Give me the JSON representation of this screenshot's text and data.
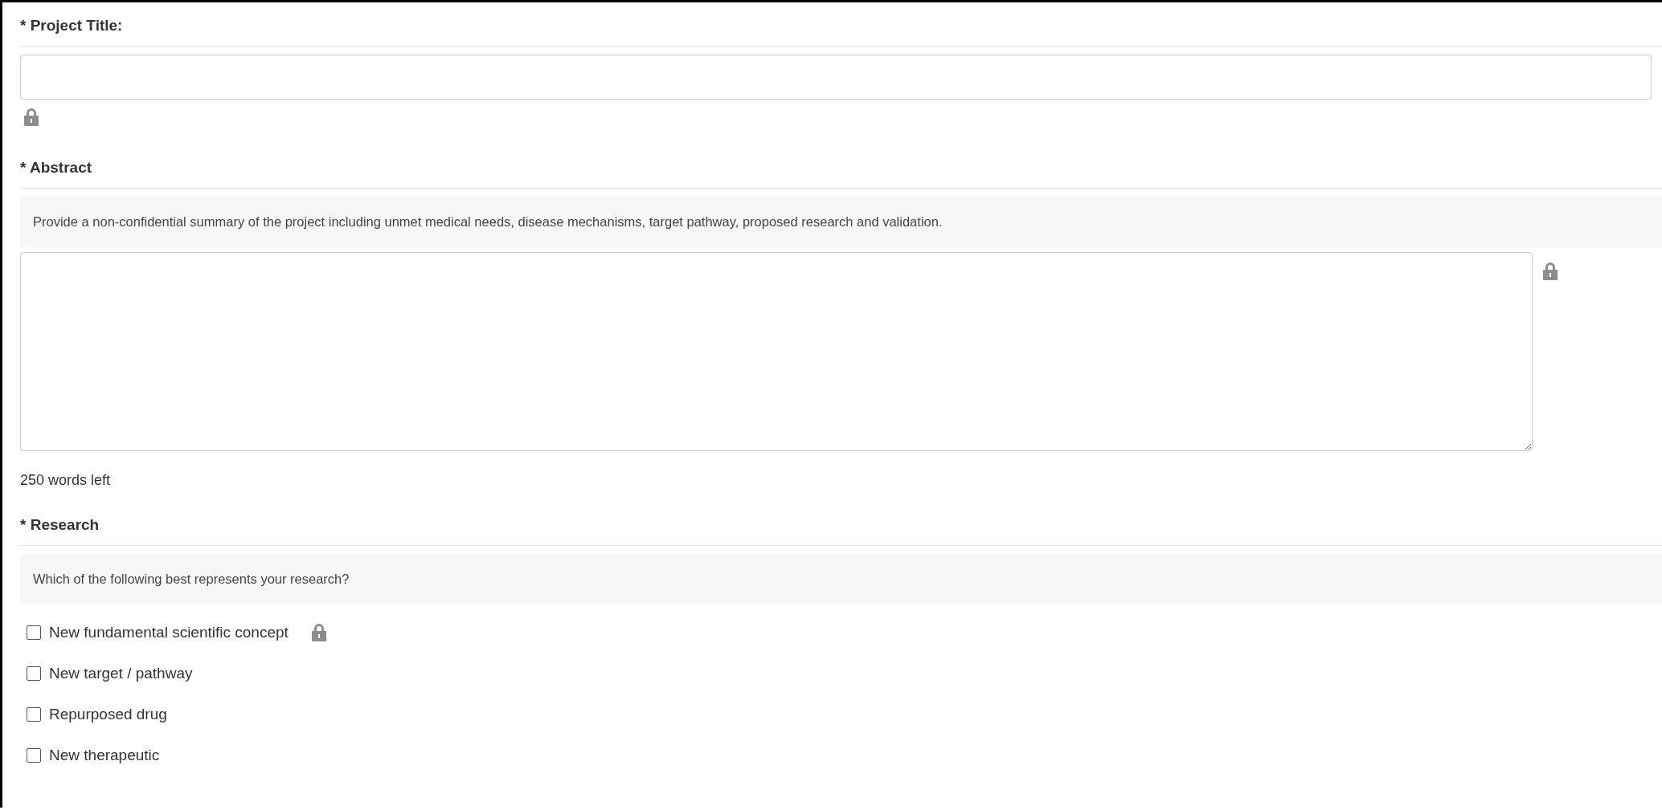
{
  "fields": [
    {
      "kind": "text",
      "label": "* Project Title:",
      "locked": true
    },
    {
      "kind": "textarea",
      "label": "* Abstract",
      "hint": "Provide a non-confidential summary of the project including unmet medical needs, disease mechanisms, target pathway, proposed research and validation.",
      "locked": true,
      "counter": "250 words left"
    },
    {
      "kind": "checkboxes",
      "label": "* Research",
      "hint": "Which of the following best represents your research?",
      "options": [
        {
          "label": "New fundamental scientific concept",
          "checked": false,
          "locked": true
        },
        {
          "label": "New target / pathway",
          "checked": false,
          "locked": false
        },
        {
          "label": "Repurposed drug",
          "checked": false,
          "locked": false
        },
        {
          "label": "New therapeutic",
          "checked": false,
          "locked": false
        }
      ]
    }
  ]
}
